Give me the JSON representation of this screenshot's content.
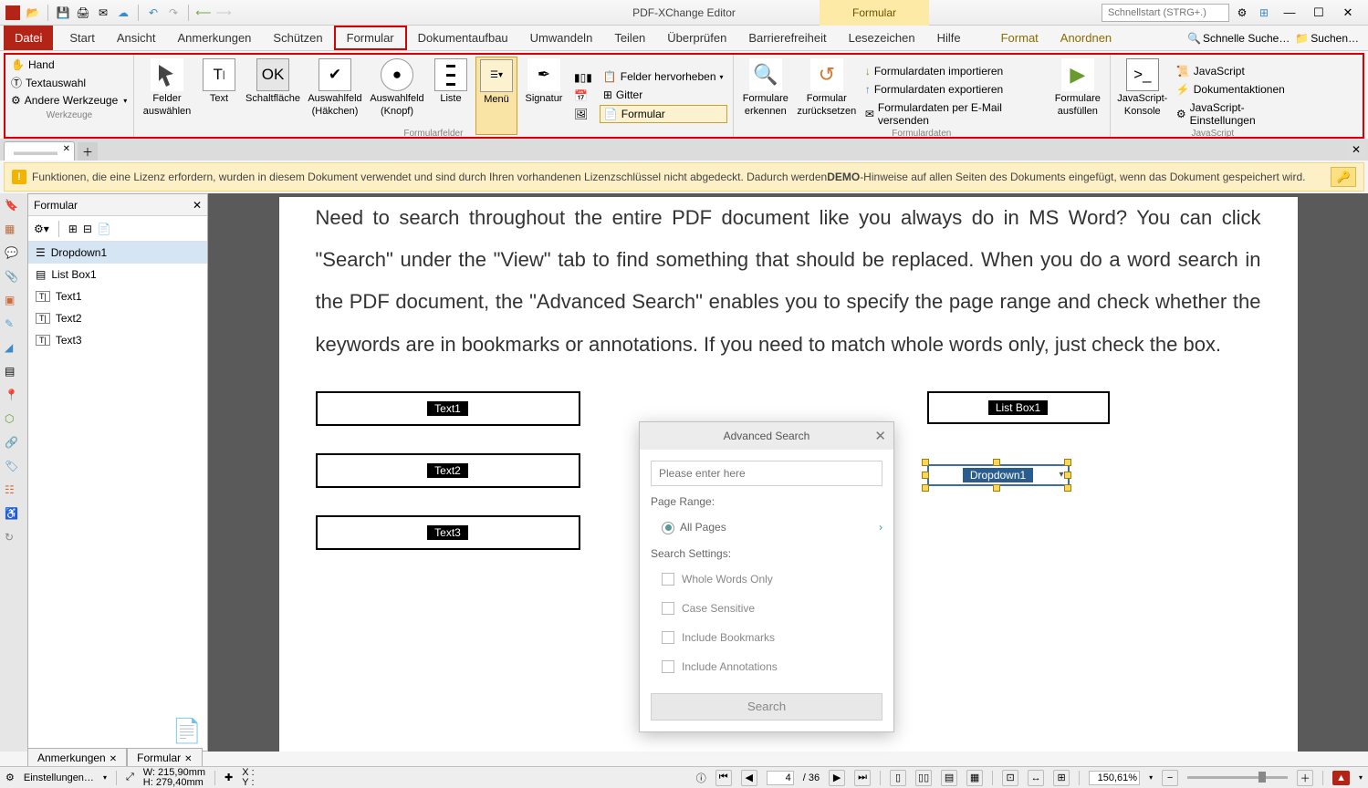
{
  "app_title": "PDF-XChange Editor",
  "context_tab": "Formular",
  "quicksearch_placeholder": "Schnellstart (STRG+.)",
  "menu": {
    "file": "Datei",
    "tabs": [
      "Start",
      "Ansicht",
      "Anmerkungen",
      "Schützen",
      "Formular",
      "Dokumentaufbau",
      "Umwandeln",
      "Teilen",
      "Überprüfen",
      "Barrierefreiheit",
      "Lesezeichen",
      "Hilfe"
    ],
    "context_tabs": [
      "Format",
      "Anordnen"
    ],
    "search_quick": "Schnelle Suche…",
    "search_full": "Suchen…"
  },
  "ribbon": {
    "tools": {
      "hand": "Hand",
      "textselect": "Textauswahl",
      "other": "Andere Werkzeuge",
      "group_label": "Werkzeuge"
    },
    "select_fields": {
      "label1": "Felder",
      "label2": "auswählen"
    },
    "text": "Text",
    "button": "Schaltfläche",
    "checkbox": {
      "l1": "Auswahlfeld",
      "l2": "(Häkchen)"
    },
    "radio": {
      "l1": "Auswahlfeld",
      "l2": "(Knopf)"
    },
    "list": "Liste",
    "menu_btn": "Menü",
    "signature": "Signatur",
    "highlight_fields": "Felder hervorheben",
    "grid": "Gitter",
    "formular_btn": "Formular",
    "formfields_label": "Formularfelder",
    "detect": {
      "l1": "Formulare",
      "l2": "erkennen"
    },
    "reset": {
      "l1": "Formular",
      "l2": "zurücksetzen"
    },
    "import": "Formulardaten importieren",
    "export": "Formulardaten exportieren",
    "email": "Formulardaten per E-Mail versenden",
    "formdata_label": "Formulardaten",
    "fillout": {
      "l1": "Formulare",
      "l2": "ausfüllen"
    },
    "jsconsole": {
      "l1": "JavaScript-",
      "l2": "Konsole"
    },
    "js": "JavaScript",
    "docactions": "Dokumentaktionen",
    "jssettings": "JavaScript-Einstellungen",
    "js_label": "JavaScript"
  },
  "doc_tab": "",
  "license_bar": {
    "before": "Funktionen, die eine Lizenz erfordern, wurden in diesem Dokument verwendet und sind durch Ihren vorhandenen Lizenzschlüssel nicht abgedeckt. Dadurch werden ",
    "demo": "DEMO",
    "after": "-Hinweise auf allen Seiten des Dokuments eingefügt, wenn das Dokument gespeichert wird."
  },
  "form_panel": {
    "title": "Formular",
    "items": [
      "Dropdown1",
      "List Box1",
      "Text1",
      "Text2",
      "Text3"
    ]
  },
  "page_text": "Need to search throughout the entire PDF document like you always do in MS Word? You can click \"Search\" under the \"View\" tab to find something that should be replaced. When you do a word search in the PDF document, the \"Advanced Search\" enables you to specify the page range and check whether the keywords are in bookmarks or annotations. If you need to match whole words only, just check the box.",
  "fields": {
    "text1": "Text1",
    "text2": "Text2",
    "text3": "Text3",
    "listbox": "List Box1",
    "dropdown": "Dropdown1"
  },
  "adv_search": {
    "title": "Advanced Search",
    "placeholder": "Please enter here",
    "page_range": "Page Range:",
    "all_pages": "All Pages",
    "settings": "Search Settings:",
    "whole_words": "Whole Words Only",
    "case_sensitive": "Case Sensitive",
    "bookmarks": "Include Bookmarks",
    "annotations": "Include Annotations",
    "search_btn": "Search"
  },
  "bottom_tabs": {
    "annotations": "Anmerkungen",
    "formular": "Formular"
  },
  "status": {
    "settings": "Einstellungen…",
    "w": "W: 215,90mm",
    "h": "H: 279,40mm",
    "x": "X :",
    "y": "Y :",
    "page": "4",
    "pages": "/ 36",
    "zoom": "150,61%"
  }
}
